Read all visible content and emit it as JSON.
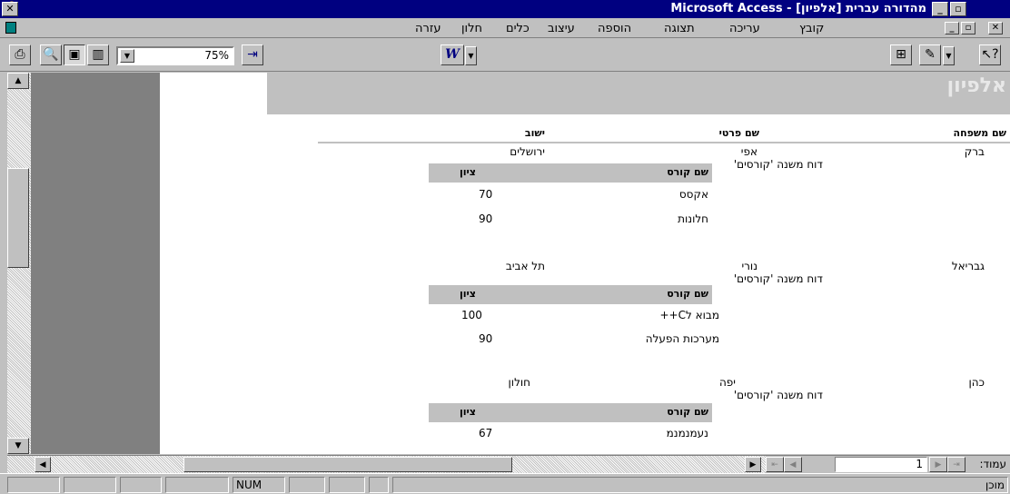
{
  "window": {
    "title": "Microsoft Access - [אלפיון]  מהדורה עברית"
  },
  "menu": [
    "קובץ",
    "עריכה",
    "תצוגה",
    "הוספה",
    "עיצוב",
    "כלים",
    "חלון",
    "עזרה"
  ],
  "toolbar": {
    "zoom": "75%"
  },
  "report": {
    "title": "אלפיון",
    "col_last": "שם משפחה",
    "col_first": "שם פרטי",
    "col_city": "ישוב",
    "subreport_label": "דוח משנה 'קורסים'",
    "sub_col_course": "שם קורס",
    "sub_col_grade": "ציון",
    "records": [
      {
        "last": "ברק",
        "first": "אפי",
        "city": "ירושלים",
        "courses": [
          {
            "name": "אקסס",
            "grade": "70"
          },
          {
            "name": "חלונות",
            "grade": "90"
          }
        ]
      },
      {
        "last": "גבריאל",
        "first": "נורי",
        "city": "תל אביב",
        "courses": [
          {
            "name": "מבוא לC++",
            "grade": "100"
          },
          {
            "name": "מערכות הפעלה",
            "grade": "90"
          }
        ]
      },
      {
        "last": "כהן",
        "first": "יפה",
        "city": "חולון",
        "courses": [
          {
            "name": "נעמנמנמ",
            "grade": "67"
          }
        ]
      }
    ]
  },
  "nav": {
    "page_label": "עמוד:",
    "page_value": "1"
  },
  "status": {
    "ready": "מוכן",
    "num": "NUM"
  }
}
